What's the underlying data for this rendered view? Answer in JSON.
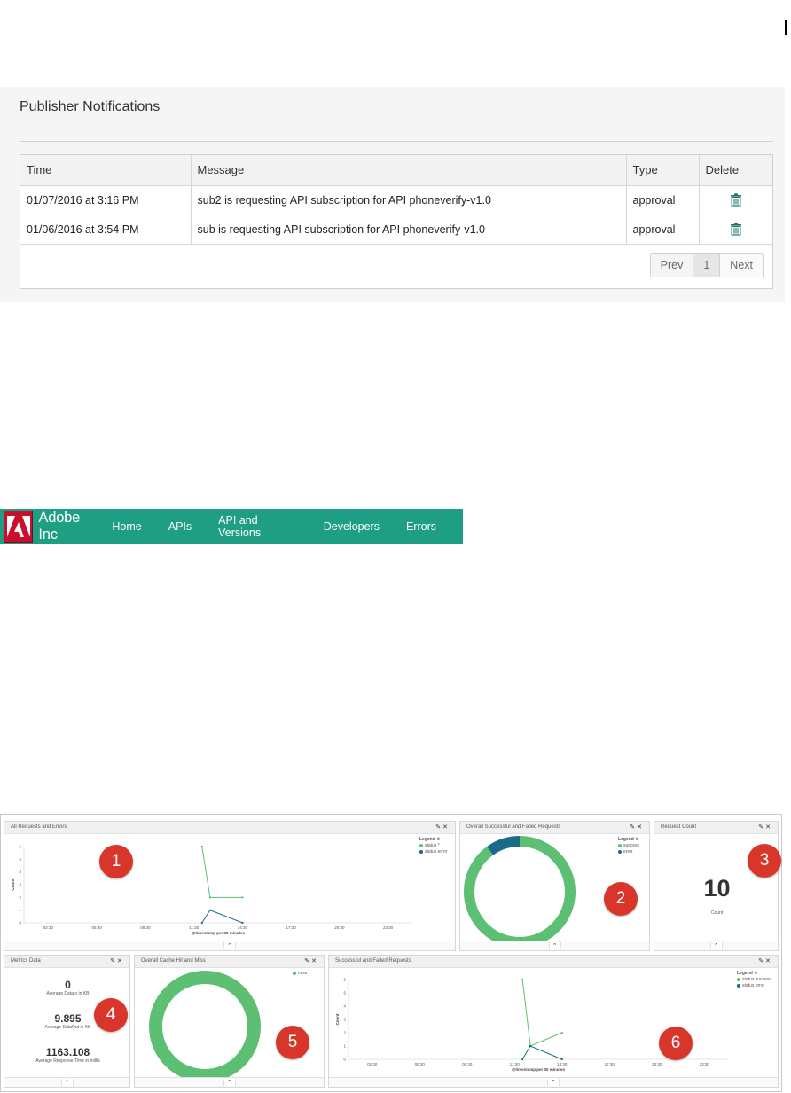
{
  "notifications": {
    "title": "Publisher Notifications",
    "columns": [
      "Time",
      "Message",
      "Type",
      "Delete"
    ],
    "rows": [
      {
        "time": "01/07/2016 at 3:16 PM",
        "message": "sub2 is requesting API subscription for API phoneverify-v1.0",
        "type": "approval"
      },
      {
        "time": "01/06/2016 at 3:54 PM",
        "message": "sub is requesting API subscription for API phoneverify-v1.0",
        "type": "approval"
      }
    ],
    "pager": {
      "prev": "Prev",
      "page": "1",
      "next": "Next"
    }
  },
  "navbar": {
    "brand": "Adobe Inc",
    "items": [
      "Home",
      "APIs",
      "API and Versions",
      "Developers",
      "Errors"
    ],
    "accent": "#1e9e82"
  },
  "dashboard": {
    "colors": {
      "success": "#5cbf74",
      "error": "#1a6a8a",
      "badge": "#d9362b"
    },
    "panels": {
      "all_requests": {
        "title": "All Requests and Errors",
        "badge": "1",
        "legend_title": "Legend",
        "legend": [
          "status *",
          "status error"
        ],
        "ylabel": "Count",
        "xlabel": "@timestamp per 30 minutes"
      },
      "overall_success": {
        "title": "Overall Successful and Failed Requests",
        "badge": "2",
        "legend_title": "Legend",
        "legend": [
          "success",
          "error"
        ]
      },
      "request_count": {
        "title": "Request Count",
        "badge": "3",
        "value": "10",
        "label": "Count"
      },
      "metrics": {
        "title": "Metrics Data",
        "badge": "4",
        "items": [
          {
            "value": "0",
            "label": "Average DataIn in KB"
          },
          {
            "value": "9.895",
            "label": "Average DataOut in KB"
          },
          {
            "value": "1163.108",
            "label": "Average Response Time in millis"
          }
        ]
      },
      "cache": {
        "title": "Overall Cache Hit and Miss",
        "badge": "5",
        "legend": [
          "miss"
        ]
      },
      "success_failed": {
        "title": "Successful and Failed Requests",
        "badge": "6",
        "legend_title": "Legend",
        "legend": [
          "status success",
          "status error"
        ],
        "ylabel": "Count",
        "xlabel": "@timestamp per 30 minutes"
      }
    }
  },
  "chart_data": [
    {
      "type": "line",
      "title": "All Requests and Errors",
      "xlabel": "@timestamp per 30 minutes",
      "ylabel": "Count",
      "x_ticks": [
        "02:30",
        "05:30",
        "08:30",
        "11:30",
        "14:30",
        "17:30",
        "20:30",
        "23:30"
      ],
      "y_ticks": [
        "0",
        "1",
        "2",
        "3",
        "4",
        "5",
        "6"
      ],
      "ylim": [
        0,
        6
      ],
      "series": [
        {
          "name": "status *",
          "points": [
            [
              "12:00",
              6
            ],
            [
              "12:30",
              2
            ],
            [
              "14:30",
              2
            ]
          ]
        },
        {
          "name": "status error",
          "points": [
            [
              "12:00",
              0
            ],
            [
              "12:30",
              1
            ],
            [
              "14:30",
              0
            ]
          ]
        }
      ]
    },
    {
      "type": "pie",
      "title": "Overall Successful and Failed Requests",
      "categories": [
        "success",
        "error"
      ],
      "values": [
        9,
        1
      ]
    },
    {
      "type": "pie",
      "title": "Overall Cache Hit and Miss",
      "categories": [
        "miss"
      ],
      "values": [
        1
      ]
    },
    {
      "type": "line",
      "title": "Successful and Failed Requests",
      "xlabel": "@timestamp per 30 minutes",
      "ylabel": "Count",
      "x_ticks": [
        "02:30",
        "05:30",
        "08:30",
        "11:30",
        "14:30",
        "17:30",
        "20:30",
        "23:30"
      ],
      "y_ticks": [
        "0",
        "1",
        "2",
        "3",
        "4",
        "5",
        "6"
      ],
      "ylim": [
        0,
        6
      ],
      "series": [
        {
          "name": "status success",
          "points": [
            [
              "12:00",
              6
            ],
            [
              "12:30",
              1
            ],
            [
              "14:30",
              2
            ]
          ]
        },
        {
          "name": "status error",
          "points": [
            [
              "12:00",
              0
            ],
            [
              "12:30",
              1
            ],
            [
              "14:30",
              0
            ]
          ]
        }
      ]
    }
  ]
}
